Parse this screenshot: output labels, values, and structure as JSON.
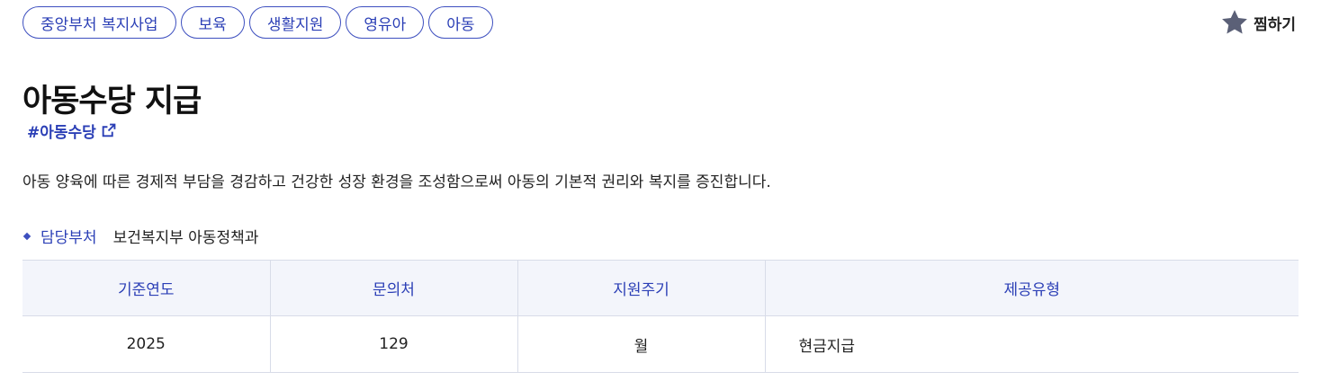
{
  "tags": [
    "중앙부처 복지사업",
    "보육",
    "생활지원",
    "영유아",
    "아동"
  ],
  "favorite": {
    "label": "찜하기",
    "icon": "star-icon"
  },
  "title": "아동수당 지급",
  "hashtag": {
    "label": "#아동수당",
    "icon": "external-link-icon"
  },
  "description": "아동 양육에 따른 경제적 부담을 경감하고 건강한 성장 환경을 조성함으로써 아동의 기본적 권리와 복지를 증진합니다.",
  "department": {
    "label": "담당부처",
    "value": "보건복지부 아동정책과"
  },
  "table": {
    "headers": [
      "기준연도",
      "문의처",
      "지원주기",
      "제공유형"
    ],
    "rows": [
      [
        "2025",
        "129",
        "월",
        "현금지급"
      ]
    ]
  },
  "colors": {
    "accent": "#2b3fb6",
    "header_bg": "#f3f5fb",
    "star": "#5b6077"
  }
}
